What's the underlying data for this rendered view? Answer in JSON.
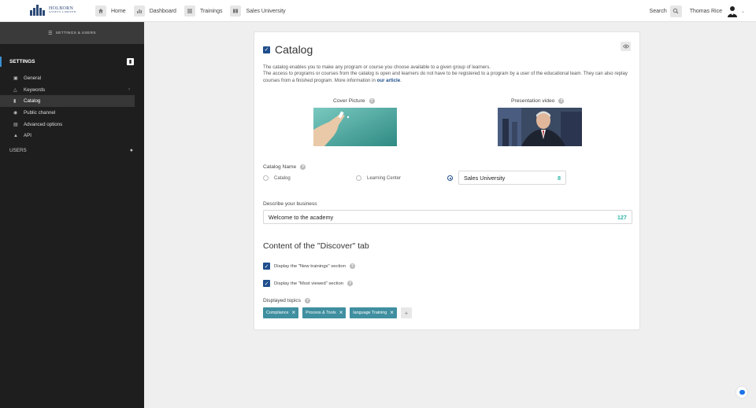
{
  "header": {
    "logo_name": "HOLBORN",
    "logo_sub": "ASSETS LIMITED",
    "nav": [
      {
        "label": "Home",
        "icon": "home-icon"
      },
      {
        "label": "Dashboard",
        "icon": "bar-chart-icon"
      },
      {
        "label": "Trainings",
        "icon": "list-icon"
      },
      {
        "label": "Sales University",
        "icon": "catalog-icon"
      }
    ],
    "search_label": "Search",
    "user_name": "Thomas Rice"
  },
  "sidebar": {
    "header": "SETTINGS & USERS",
    "settings_title": "SETTINGS",
    "items": [
      {
        "label": "General",
        "icon": "image-icon",
        "active": false
      },
      {
        "label": "Keywords",
        "icon": "tag-icon",
        "active": false
      },
      {
        "label": "Catalog",
        "icon": "book-icon",
        "active": true
      },
      {
        "label": "Public channel",
        "icon": "globe-icon",
        "active": false
      },
      {
        "label": "Advanced options",
        "icon": "sliders-icon",
        "active": false
      },
      {
        "label": "API",
        "icon": "plug-icon",
        "active": false
      }
    ],
    "users_title": "USERS"
  },
  "card": {
    "title": "Catalog",
    "description_1": "The catalog enables you to make any program or course you choose available to a given group of learners.",
    "description_2": "The access to programs or courses from the catalog is open and learners do not have to be registered to a program by a user of the educational team. They can also replay courses from a finished program. More information in ",
    "description_link": "our article",
    "description_end": ".",
    "cover_label": "Cover Picture",
    "video_label": "Presentation video",
    "catalog_name_label": "Catalog Name",
    "radio_options": [
      "Catalog",
      "Learning Center",
      ""
    ],
    "custom_name": "Sales University",
    "custom_name_count": "8",
    "business_label": "Describe your business",
    "business_value": "Welcome to the  academy",
    "business_count": "127",
    "discover_title": "Content of the \"Discover\" tab",
    "check_new": "Display the \"New trainings\" section",
    "check_viewed": "Display the \"Most viewed\" section",
    "topics_label": "Displayed topics",
    "topics": [
      "Compliance",
      "Process & Tools",
      "language Training"
    ]
  },
  "colors": {
    "accent": "#1f4e8c",
    "teal": "#2db5a6",
    "tag": "#3f8fa0",
    "sidebar_bg": "#1e1e1e"
  }
}
